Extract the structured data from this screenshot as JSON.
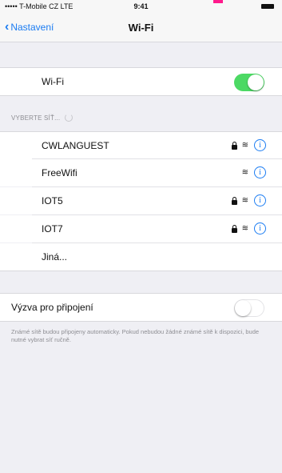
{
  "status_bar": {
    "carrier": "••••• T-Mobile CZ  LTE",
    "time": "9:41"
  },
  "nav": {
    "back_label": "Nastavení",
    "title": "Wi-Fi"
  },
  "wifi_toggle": {
    "label": "Wi-Fi",
    "on": true
  },
  "networks_section": {
    "header": "VYBERTE SÍŤ..."
  },
  "networks": [
    {
      "name": "CWLANGUEST",
      "locked": true
    },
    {
      "name": "FreeWifi",
      "locked": false
    },
    {
      "name": "IOT5",
      "locked": true
    },
    {
      "name": "IOT7",
      "locked": true
    }
  ],
  "other_network_label": "Jiná...",
  "ask_to_join": {
    "label": "Výzva pro připojení",
    "on": false,
    "description": "Známé sítě budou připojeny automaticky. Pokud nebudou žádné známé sítě k dispozici, bude nutné vybrat síť ručně."
  },
  "colors": {
    "accent": "#1b7cf2",
    "toggle_on": "#4cd964",
    "background": "#efeff4"
  }
}
